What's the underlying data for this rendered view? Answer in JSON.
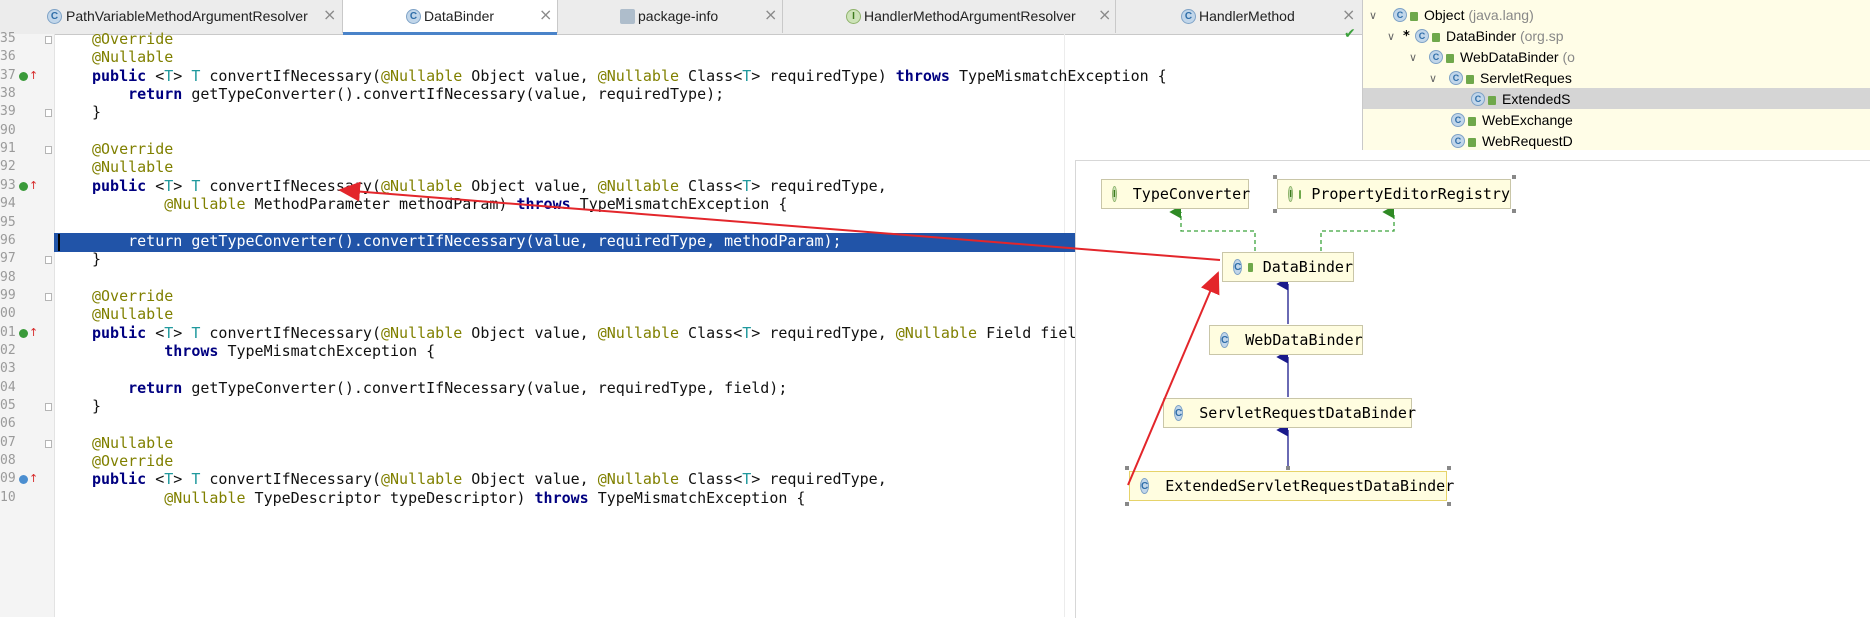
{
  "tabs": [
    {
      "label": "PathVariableMethodArgumentResolver",
      "icon": "class-icon",
      "active": false
    },
    {
      "label": "DataBinder",
      "icon": "class-icon",
      "active": true
    },
    {
      "label": "package-info",
      "icon": "package-icon",
      "active": false
    },
    {
      "label": "HandlerMethodArgumentResolver",
      "icon": "interface-icon",
      "active": false
    },
    {
      "label": "HandlerMethod",
      "icon": "class-icon",
      "active": false
    }
  ],
  "line_numbers": [
    "35",
    "36",
    "37",
    "38",
    "39",
    "90",
    "91",
    "92",
    "93",
    "94",
    "95",
    "96",
    "97",
    "98",
    "99",
    "00",
    "01",
    "02",
    "03",
    "04",
    "05",
    "06",
    "07",
    "08",
    "09",
    "10"
  ],
  "code_lines": [
    "@Override",
    "@Nullable",
    "public <T> T convertIfNecessary(@Nullable Object value, @Nullable Class<T> requiredType) throws TypeMismatchException {",
    "    return getTypeConverter().convertIfNecessary(value, requiredType);",
    "}",
    "",
    "@Override",
    "@Nullable",
    "public <T> T convertIfNecessary(@Nullable Object value, @Nullable Class<T> requiredType,",
    "        @Nullable MethodParameter methodParam) throws TypeMismatchException {",
    "",
    "    return getTypeConverter().convertIfNecessary(value, requiredType, methodParam);",
    "}",
    "",
    "@Override",
    "@Nullable",
    "public <T> T convertIfNecessary(@Nullable Object value, @Nullable Class<T> requiredType, @Nullable Field field)",
    "        throws TypeMismatchException {",
    "",
    "    return getTypeConverter().convertIfNecessary(value, requiredType, field);",
    "}",
    "",
    "@Nullable",
    "@Override",
    "public <T> T convertIfNecessary(@Nullable Object value, @Nullable Class<T> requiredType,",
    "        @Nullable TypeDescriptor typeDescriptor) throws TypeMismatchException {"
  ],
  "hierarchy_tree": {
    "items": [
      {
        "name": "Object",
        "pkg": "(java.lang)"
      },
      {
        "name": "DataBinder",
        "pkg": "(org.sp"
      },
      {
        "name": "WebDataBinder",
        "pkg": "(o"
      },
      {
        "name": "ServletReques",
        "pkg": ""
      },
      {
        "name": "ExtendedS",
        "pkg": ""
      },
      {
        "name": "WebExchange",
        "pkg": ""
      },
      {
        "name": "WebRequestD",
        "pkg": ""
      }
    ]
  },
  "diagram": {
    "nodes": [
      {
        "label": "TypeConverter",
        "kind": "interface"
      },
      {
        "label": "PropertyEditorRegistry",
        "kind": "interface"
      },
      {
        "label": "DataBinder",
        "kind": "class"
      },
      {
        "label": "WebDataBinder",
        "kind": "class"
      },
      {
        "label": "ServletRequestDataBinder",
        "kind": "class"
      },
      {
        "label": "ExtendedServletRequestDataBinder",
        "kind": "class"
      }
    ]
  },
  "colors": {
    "selection": "#2154a8",
    "keyword": "#000080",
    "annotation": "#808000",
    "type_param": "#20999d",
    "annotation_arrow": "#e3262b"
  }
}
